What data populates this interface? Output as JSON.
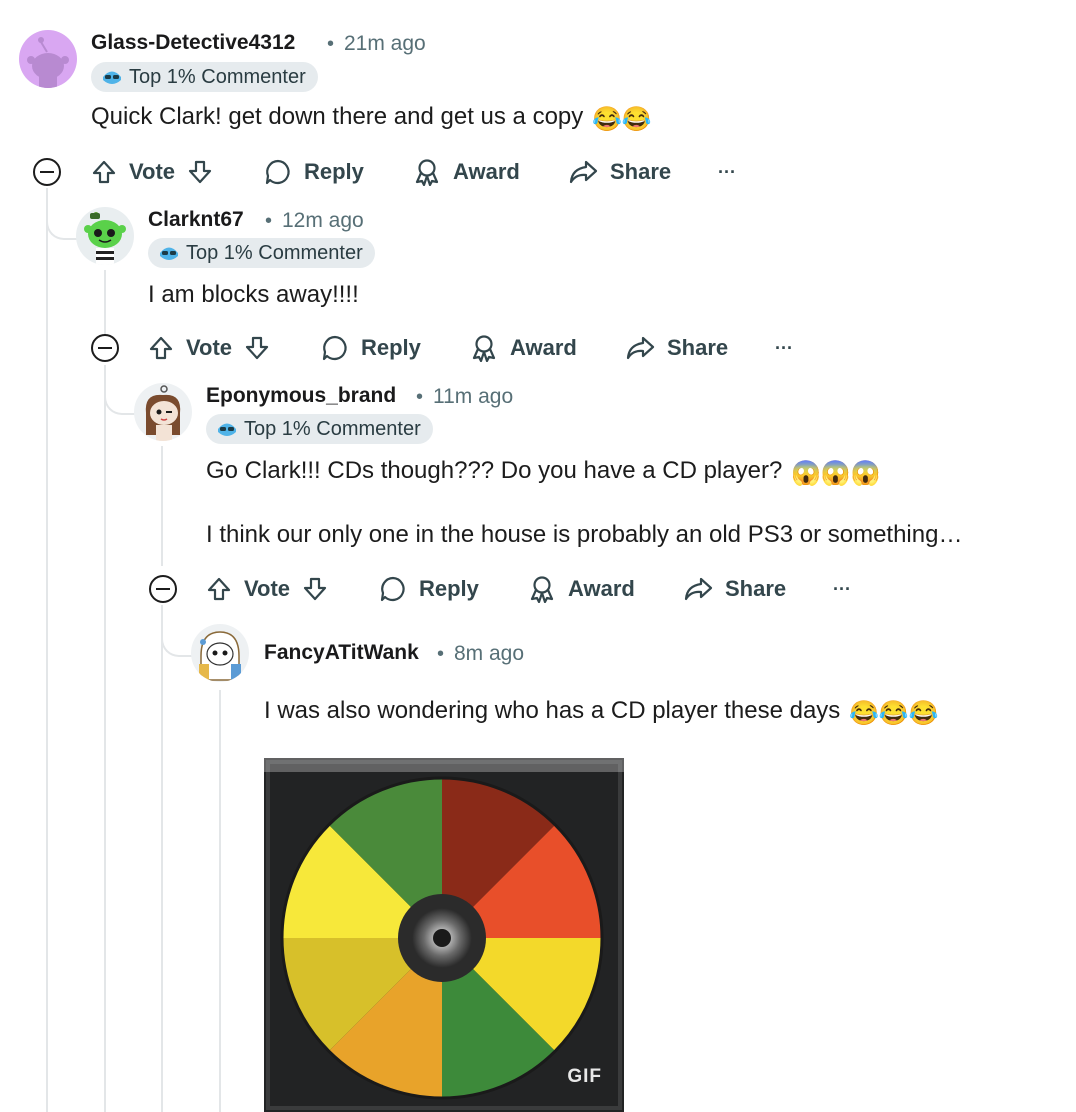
{
  "comments": [
    {
      "username": "Glass-Detective4312",
      "time": "21m ago",
      "flair": "Top 1% Commenter",
      "text": "Quick Clark! get down there and get us a copy",
      "emoji": "😂😂",
      "avatar_color": "#d9a7f2"
    },
    {
      "username": "Clarknt67",
      "time": "12m ago",
      "flair": "Top 1% Commenter",
      "text": "I am blocks away!!!!",
      "avatar_color": "#5ad14a"
    },
    {
      "username": "Eponymous_brand",
      "time": "11m ago",
      "flair": "Top 1% Commenter",
      "text": "Go Clark!!! CDs though??? Do you have a CD player?",
      "emoji": "😱😱😱",
      "text2": "I think our only one in the house is probably an old PS3 or something…",
      "avatar_color": "#f3e3d6"
    },
    {
      "username": "FancyATitWank",
      "time": "8m ago",
      "text": "I was also wondering who has a CD player these days",
      "emoji": "😂😂😂",
      "media_label": "GIF",
      "avatar_color": "#f4f4f4"
    }
  ],
  "actions": {
    "vote": "Vote",
    "reply": "Reply",
    "award": "Award",
    "share": "Share",
    "more": "···"
  },
  "separator": "•",
  "colors": {
    "meta_text": "#576f76",
    "action_text": "#33464c",
    "thread_line": "#e3e6e8",
    "flair_bg": "#e6ebee"
  }
}
